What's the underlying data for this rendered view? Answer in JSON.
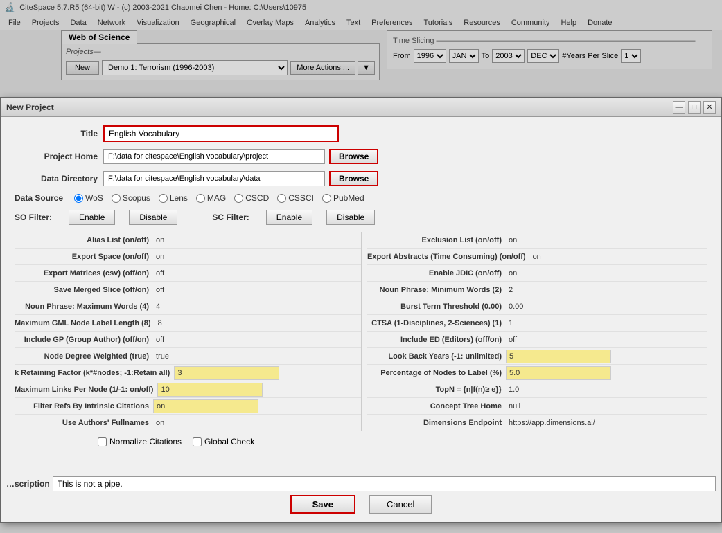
{
  "app": {
    "title": "CiteSpace 5.7.R5 (64-bit) W - (c) 2003-2021 Chaomei Chen - Home: C:\\Users\\10975",
    "icon": "🔬"
  },
  "menu": {
    "items": [
      "File",
      "Projects",
      "Data",
      "Network",
      "Visualization",
      "Geographical",
      "Overlay Maps",
      "Analytics",
      "Text",
      "Preferences",
      "Tutorials",
      "Resources",
      "Community",
      "Help",
      "Donate"
    ]
  },
  "wos_tab": {
    "label": "Web of Science"
  },
  "projects": {
    "label": "Projects",
    "new_label": "New",
    "current_project": "Demo 1: Terrorism (1996-2003)",
    "more_actions_label": "More Actions ..."
  },
  "time_slicing": {
    "title": "Time Slicing",
    "from_label": "From",
    "to_label": "To",
    "years_label": "#Years Per Slice",
    "from_year": "1996",
    "from_month": "JAN",
    "to_year": "2003",
    "to_month": "DEC",
    "years_per_slice": "1"
  },
  "dialog": {
    "title": "New Project",
    "title_label": "Title",
    "title_value": "English Vocabulary",
    "project_home_label": "Project Home",
    "project_home_value": "F:\\data for citespace\\English vocabulary\\project",
    "browse_label_1": "Browse",
    "data_dir_label": "Data Directory",
    "data_dir_value": "F:\\data for citespace\\English vocabulary\\data",
    "browse_label_2": "Browse",
    "data_source_label": "Data Source",
    "data_sources": [
      "WoS",
      "Scopus",
      "Lens",
      "MAG",
      "CSCD",
      "CSSCI",
      "PubMed"
    ],
    "data_source_selected": "WoS",
    "so_filter_label": "SO Filter:",
    "so_enable": "Enable",
    "so_disable": "Disable",
    "sc_filter_label": "SC Filter:",
    "sc_enable": "Enable",
    "sc_disable": "Disable",
    "settings_left": [
      {
        "name": "Alias List (on/off)",
        "value": "on",
        "highlight": false
      },
      {
        "name": "Export Space (on/off)",
        "value": "on",
        "highlight": false
      },
      {
        "name": "Export Matrices (csv) (off/on)",
        "value": "off",
        "highlight": false
      },
      {
        "name": "Save Merged Slice (off/on)",
        "value": "off",
        "highlight": false
      },
      {
        "name": "Noun Phrase: Maximum Words (4)",
        "value": "4",
        "highlight": false
      },
      {
        "name": "Maximum GML Node Label Length (8)",
        "value": "8",
        "highlight": false
      },
      {
        "name": "Include GP (Group Author) (off/on)",
        "value": "off",
        "highlight": false
      },
      {
        "name": "Node Degree Weighted (true)",
        "value": "true",
        "highlight": false
      },
      {
        "name": "k Retaining Factor (k*#nodes; -1:Retain all)",
        "value": "3",
        "highlight": true
      },
      {
        "name": "Maximum Links Per Node (1/-1: on/off)",
        "value": "10",
        "highlight": true
      },
      {
        "name": "Filter Refs By Intrinsic Citations",
        "value": "on",
        "highlight": true
      },
      {
        "name": "Use Authors' Fullnames",
        "value": "on",
        "highlight": false
      }
    ],
    "settings_right": [
      {
        "name": "Exclusion List (on/off)",
        "value": "on",
        "highlight": false
      },
      {
        "name": "Export Abstracts (Time Consuming) (on/off)",
        "value": "on",
        "highlight": false
      },
      {
        "name": "Enable JDIC (on/off)",
        "value": "on",
        "highlight": false
      },
      {
        "name": "Noun Phrase: Minimum Words (2)",
        "value": "2",
        "highlight": false
      },
      {
        "name": "Burst Term Threshold (0.00)",
        "value": "0.00",
        "highlight": false
      },
      {
        "name": "CTSA (1-Disciplines, 2-Sciences) (1)",
        "value": "1",
        "highlight": false
      },
      {
        "name": "Include ED (Editors) (off/on)",
        "value": "off",
        "highlight": false
      },
      {
        "name": "Look Back Years (-1: unlimited)",
        "value": "5",
        "highlight": true
      },
      {
        "name": "Percentage of Nodes to Label (%)",
        "value": "5.0",
        "highlight": true
      },
      {
        "name": "TopN = {n|f(n)≥ e}}",
        "value": "1.0",
        "highlight": false
      },
      {
        "name": "Concept Tree Home",
        "value": "null",
        "highlight": false
      },
      {
        "name": "Dimensions Endpoint",
        "value": "https://app.dimensions.ai/",
        "highlight": false
      }
    ],
    "normalize_citations": "Normalize Citations",
    "global_check": "Global Check",
    "description_label": "scription",
    "description_value": "This is not a pipe.",
    "save_label": "Save",
    "cancel_label": "Cancel"
  }
}
